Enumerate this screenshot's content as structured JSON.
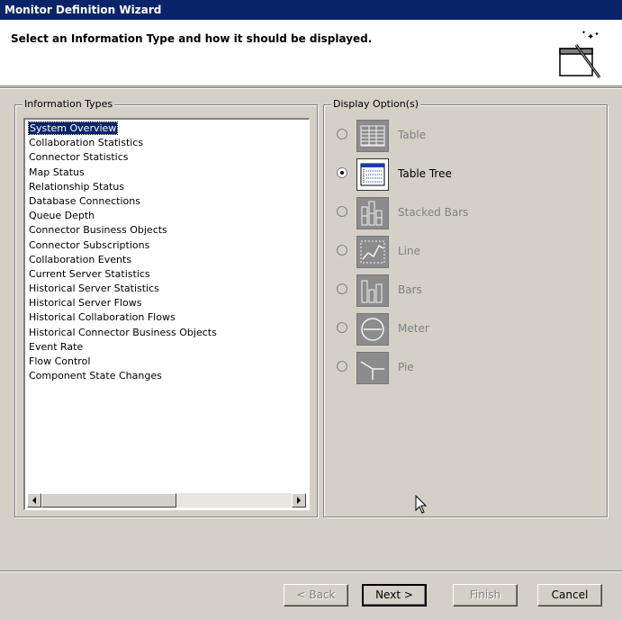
{
  "window": {
    "title": "Monitor Definition Wizard"
  },
  "header": {
    "instruction": "Select an Information Type and how it should be displayed."
  },
  "information_types": {
    "label": "Information Types",
    "selected_index": 0,
    "items": [
      "System Overview",
      "Collaboration Statistics",
      "Connector Statistics",
      "Map Status",
      "Relationship Status",
      "Database Connections",
      "Queue Depth",
      "Connector Business Objects",
      "Connector Subscriptions",
      "Collaboration Events",
      "Current Server Statistics",
      "Historical Server Statistics",
      "Historical Server Flows",
      "Historical Collaboration Flows",
      "Historical Connector Business Objects",
      "Event Rate",
      "Flow Control",
      "Component State Changes"
    ]
  },
  "display_options": {
    "label": "Display Option(s)",
    "options": [
      {
        "label": "Table",
        "icon": "table-icon",
        "enabled": false,
        "selected": false
      },
      {
        "label": "Table Tree",
        "icon": "table-tree-icon",
        "enabled": true,
        "selected": true
      },
      {
        "label": "Stacked Bars",
        "icon": "stacked-bars-icon",
        "enabled": false,
        "selected": false
      },
      {
        "label": "Line",
        "icon": "line-chart-icon",
        "enabled": false,
        "selected": false
      },
      {
        "label": "Bars",
        "icon": "bars-icon",
        "enabled": false,
        "selected": false
      },
      {
        "label": "Meter",
        "icon": "meter-icon",
        "enabled": false,
        "selected": false
      },
      {
        "label": "Pie",
        "icon": "pie-icon",
        "enabled": false,
        "selected": false
      }
    ]
  },
  "buttons": {
    "back": {
      "label": "< Back",
      "enabled": false
    },
    "next": {
      "label": "Next >",
      "enabled": true
    },
    "finish": {
      "label": "Finish",
      "enabled": false
    },
    "cancel": {
      "label": "Cancel",
      "enabled": true
    }
  }
}
